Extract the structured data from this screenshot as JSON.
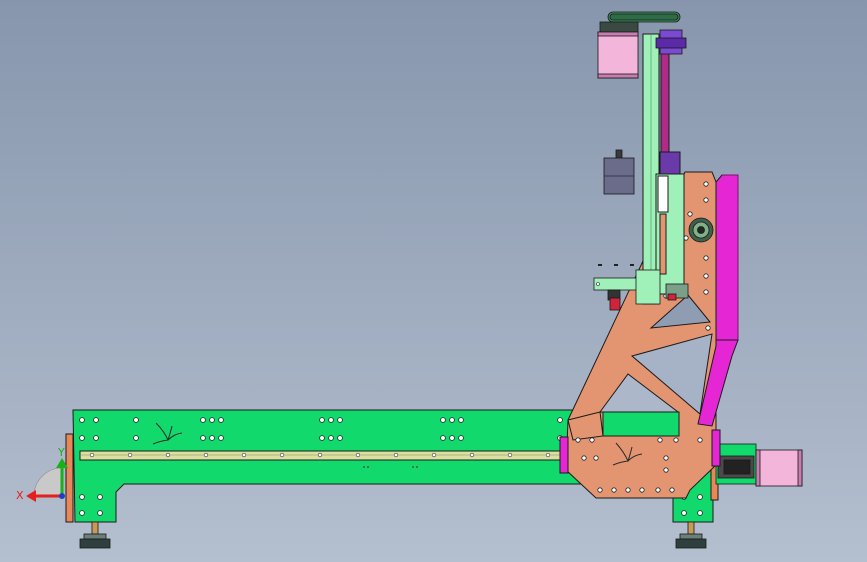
{
  "viewport": {
    "background_top": "#8796ad",
    "background_bottom": "#b4bfcf"
  },
  "triad": {
    "x_label": "X",
    "y_label": "Y",
    "x_color": "#e3201b",
    "y_color": "#19b01a"
  },
  "colors": {
    "base_frame": "#12d96c",
    "gantry_plate": "#e39572",
    "magenta_parts": "#e526d4",
    "rail": "#d9e0a0",
    "column": "#9ff0b9",
    "motor_body": "#f3b5da",
    "outline": "#1a1a1a"
  }
}
